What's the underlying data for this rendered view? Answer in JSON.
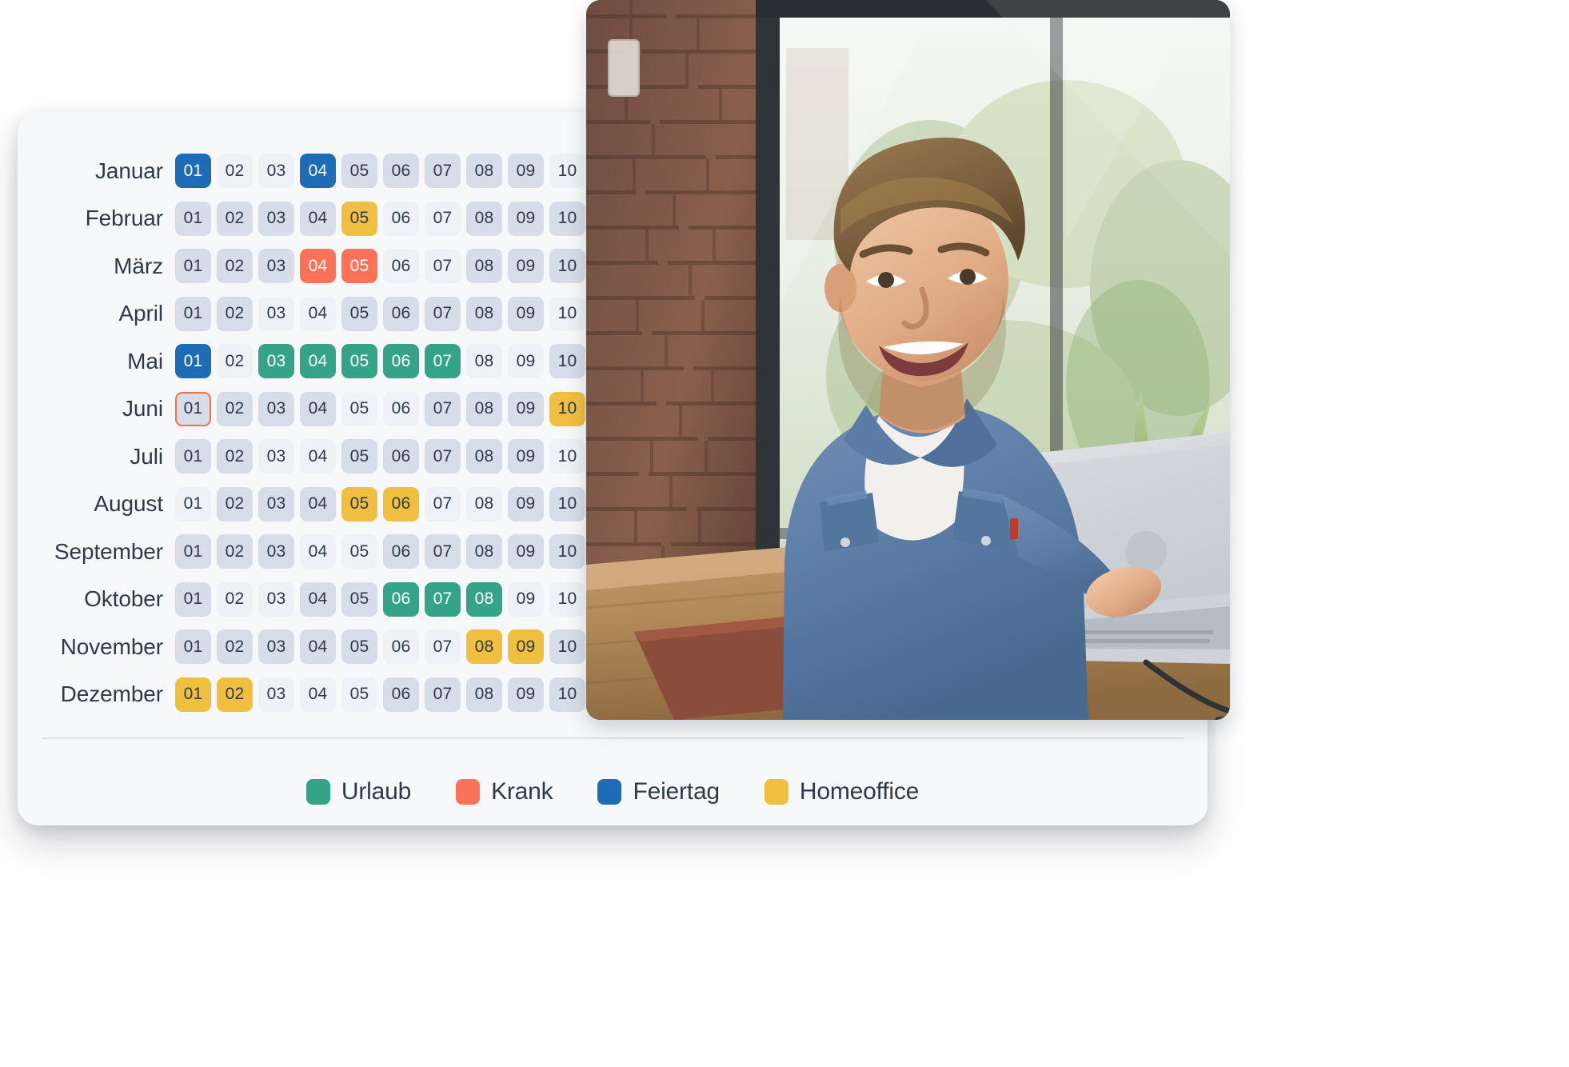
{
  "calendar": {
    "day_columns": [
      "01",
      "02",
      "03",
      "04",
      "05",
      "06",
      "07",
      "08",
      "09",
      "10"
    ],
    "today_marker": {
      "month": "Juni",
      "day": "01",
      "outline_color": "#fc6d4d"
    },
    "rows": [
      {
        "month": "Januar",
        "days": [
          {
            "label": "01",
            "status": "feiertag"
          },
          {
            "label": "02",
            "status": "light"
          },
          {
            "label": "03",
            "status": "light"
          },
          {
            "label": "04",
            "status": "feiertag"
          },
          {
            "label": "05",
            "status": "dark"
          },
          {
            "label": "06",
            "status": "dark"
          },
          {
            "label": "07",
            "status": "dark"
          },
          {
            "label": "08",
            "status": "dark"
          },
          {
            "label": "09",
            "status": "dark"
          },
          {
            "label": "10",
            "status": "light"
          }
        ]
      },
      {
        "month": "Februar",
        "days": [
          {
            "label": "01",
            "status": "dark"
          },
          {
            "label": "02",
            "status": "dark"
          },
          {
            "label": "03",
            "status": "dark"
          },
          {
            "label": "04",
            "status": "dark"
          },
          {
            "label": "05",
            "status": "homeoffice"
          },
          {
            "label": "06",
            "status": "light"
          },
          {
            "label": "07",
            "status": "light"
          },
          {
            "label": "08",
            "status": "dark"
          },
          {
            "label": "09",
            "status": "dark"
          },
          {
            "label": "10",
            "status": "dark"
          }
        ]
      },
      {
        "month": "März",
        "days": [
          {
            "label": "01",
            "status": "dark"
          },
          {
            "label": "02",
            "status": "dark"
          },
          {
            "label": "03",
            "status": "dark"
          },
          {
            "label": "04",
            "status": "krank"
          },
          {
            "label": "05",
            "status": "krank"
          },
          {
            "label": "06",
            "status": "light"
          },
          {
            "label": "07",
            "status": "light"
          },
          {
            "label": "08",
            "status": "dark"
          },
          {
            "label": "09",
            "status": "dark"
          },
          {
            "label": "10",
            "status": "dark"
          }
        ]
      },
      {
        "month": "April",
        "days": [
          {
            "label": "01",
            "status": "dark"
          },
          {
            "label": "02",
            "status": "dark"
          },
          {
            "label": "03",
            "status": "light"
          },
          {
            "label": "04",
            "status": "light"
          },
          {
            "label": "05",
            "status": "dark"
          },
          {
            "label": "06",
            "status": "dark"
          },
          {
            "label": "07",
            "status": "dark"
          },
          {
            "label": "08",
            "status": "dark"
          },
          {
            "label": "09",
            "status": "dark"
          },
          {
            "label": "10",
            "status": "light"
          }
        ]
      },
      {
        "month": "Mai",
        "days": [
          {
            "label": "01",
            "status": "feiertag"
          },
          {
            "label": "02",
            "status": "light"
          },
          {
            "label": "03",
            "status": "urlaub"
          },
          {
            "label": "04",
            "status": "urlaub"
          },
          {
            "label": "05",
            "status": "urlaub"
          },
          {
            "label": "06",
            "status": "urlaub"
          },
          {
            "label": "07",
            "status": "urlaub"
          },
          {
            "label": "08",
            "status": "light"
          },
          {
            "label": "09",
            "status": "light"
          },
          {
            "label": "10",
            "status": "dark"
          }
        ]
      },
      {
        "month": "Juni",
        "days": [
          {
            "label": "01",
            "status": "dark",
            "today": true
          },
          {
            "label": "02",
            "status": "dark"
          },
          {
            "label": "03",
            "status": "dark"
          },
          {
            "label": "04",
            "status": "dark"
          },
          {
            "label": "05",
            "status": "light"
          },
          {
            "label": "06",
            "status": "light"
          },
          {
            "label": "07",
            "status": "dark"
          },
          {
            "label": "08",
            "status": "dark"
          },
          {
            "label": "09",
            "status": "dark"
          },
          {
            "label": "10",
            "status": "homeoffice"
          }
        ]
      },
      {
        "month": "Juli",
        "days": [
          {
            "label": "01",
            "status": "dark"
          },
          {
            "label": "02",
            "status": "dark"
          },
          {
            "label": "03",
            "status": "light"
          },
          {
            "label": "04",
            "status": "light"
          },
          {
            "label": "05",
            "status": "dark"
          },
          {
            "label": "06",
            "status": "dark"
          },
          {
            "label": "07",
            "status": "dark"
          },
          {
            "label": "08",
            "status": "dark"
          },
          {
            "label": "09",
            "status": "dark"
          },
          {
            "label": "10",
            "status": "light"
          }
        ]
      },
      {
        "month": "August",
        "days": [
          {
            "label": "01",
            "status": "light"
          },
          {
            "label": "02",
            "status": "dark"
          },
          {
            "label": "03",
            "status": "dark"
          },
          {
            "label": "04",
            "status": "dark"
          },
          {
            "label": "05",
            "status": "homeoffice"
          },
          {
            "label": "06",
            "status": "homeoffice"
          },
          {
            "label": "07",
            "status": "light"
          },
          {
            "label": "08",
            "status": "light"
          },
          {
            "label": "09",
            "status": "dark"
          },
          {
            "label": "10",
            "status": "dark"
          }
        ]
      },
      {
        "month": "September",
        "days": [
          {
            "label": "01",
            "status": "dark"
          },
          {
            "label": "02",
            "status": "dark"
          },
          {
            "label": "03",
            "status": "dark"
          },
          {
            "label": "04",
            "status": "light"
          },
          {
            "label": "05",
            "status": "light"
          },
          {
            "label": "06",
            "status": "dark"
          },
          {
            "label": "07",
            "status": "dark"
          },
          {
            "label": "08",
            "status": "dark"
          },
          {
            "label": "09",
            "status": "dark"
          },
          {
            "label": "10",
            "status": "dark"
          }
        ]
      },
      {
        "month": "Oktober",
        "days": [
          {
            "label": "01",
            "status": "dark"
          },
          {
            "label": "02",
            "status": "light"
          },
          {
            "label": "03",
            "status": "light"
          },
          {
            "label": "04",
            "status": "dark"
          },
          {
            "label": "05",
            "status": "dark"
          },
          {
            "label": "06",
            "status": "urlaub"
          },
          {
            "label": "07",
            "status": "urlaub"
          },
          {
            "label": "08",
            "status": "urlaub"
          },
          {
            "label": "09",
            "status": "light"
          },
          {
            "label": "10",
            "status": "light"
          }
        ]
      },
      {
        "month": "November",
        "days": [
          {
            "label": "01",
            "status": "dark"
          },
          {
            "label": "02",
            "status": "dark"
          },
          {
            "label": "03",
            "status": "dark"
          },
          {
            "label": "04",
            "status": "dark"
          },
          {
            "label": "05",
            "status": "dark"
          },
          {
            "label": "06",
            "status": "light"
          },
          {
            "label": "07",
            "status": "light"
          },
          {
            "label": "08",
            "status": "homeoffice"
          },
          {
            "label": "09",
            "status": "homeoffice"
          },
          {
            "label": "10",
            "status": "dark"
          }
        ]
      },
      {
        "month": "Dezember",
        "days": [
          {
            "label": "01",
            "status": "homeoffice"
          },
          {
            "label": "02",
            "status": "homeoffice"
          },
          {
            "label": "03",
            "status": "light"
          },
          {
            "label": "04",
            "status": "light"
          },
          {
            "label": "05",
            "status": "light"
          },
          {
            "label": "06",
            "status": "dark"
          },
          {
            "label": "07",
            "status": "dark"
          },
          {
            "label": "08",
            "status": "dark"
          },
          {
            "label": "09",
            "status": "dark"
          },
          {
            "label": "10",
            "status": "dark"
          }
        ]
      }
    ]
  },
  "legend": {
    "items": [
      {
        "label": "Urlaub",
        "color": "#35a386"
      },
      {
        "label": "Krank",
        "color": "#fc7259"
      },
      {
        "label": "Feiertag",
        "color": "#1d6cb5"
      },
      {
        "label": "Homeoffice",
        "color": "#f0bf3f"
      }
    ]
  },
  "photo": {
    "alt": "Lächelnder Mann im Jeanshemd arbeitet am Laptop an einem Holztisch am Fenster"
  },
  "colors": {
    "card_background": "#f7f8f9",
    "cell_light": "#eef1f5",
    "cell_dark": "#d7dde8",
    "text": "#2e3a4c",
    "divider": "#dfe3e8",
    "today_outline": "#fc6d4d"
  }
}
